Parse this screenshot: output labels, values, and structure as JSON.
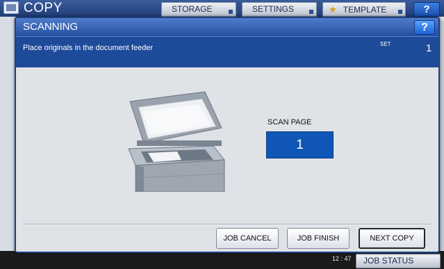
{
  "background": {
    "app_title": "COPY",
    "tabs": [
      {
        "label": "STORAGE"
      },
      {
        "label": "SETTINGS"
      },
      {
        "label": "TEMPLATE"
      }
    ],
    "help_label": "?",
    "clock": "12 : 47",
    "job_status_label": "JOB STATUS"
  },
  "dialog": {
    "title": "SCANNING",
    "help_label": "?",
    "message": "Place originals in the document feeder",
    "set_label": "SET",
    "set_value": "1",
    "scan_page_label": "SCAN PAGE",
    "scan_page_value": "1",
    "buttons": {
      "job_cancel": "JOB CANCEL",
      "job_finish": "JOB FINISH",
      "next_copy": "NEXT COPY"
    }
  },
  "colors": {
    "title_bar": "#2f5cae",
    "message_bar": "#1e4a9a",
    "scan_value_box": "#0f56b6",
    "dialog_body": "#dfe2e7"
  }
}
